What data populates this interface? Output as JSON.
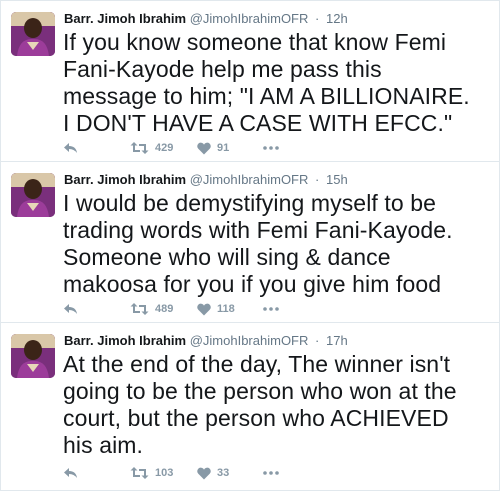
{
  "tweets": [
    {
      "author_name": "Barr. Jimoh Ibrahim",
      "handle": "@JimohIbrahimOFR",
      "separator": "·",
      "time": "12h",
      "text": "If you know someone that know Femi Fani-Kayode help me pass this message to him; \"I AM A BILLIONAIRE. I DON'T HAVE A CASE WITH EFCC.\"",
      "retweets": "429",
      "likes": "91",
      "icons": {
        "reply": "reply-icon",
        "retweet": "retweet-icon",
        "like": "heart-icon",
        "more": "more-dots-icon"
      }
    },
    {
      "author_name": "Barr. Jimoh Ibrahim",
      "handle": "@JimohIbrahimOFR",
      "separator": "·",
      "time": "15h",
      "text": "I would be demystifying myself to be trading words with Femi Fani-Kayode. Someone who will sing & dance makoosa for you if you give him food",
      "retweets": "489",
      "likes": "118",
      "icons": {
        "reply": "reply-icon",
        "retweet": "retweet-icon",
        "like": "heart-icon",
        "more": "more-dots-icon"
      }
    },
    {
      "author_name": "Barr. Jimoh Ibrahim",
      "handle": "@JimohIbrahimOFR",
      "separator": "·",
      "time": "17h",
      "text": "At the end of the day, The winner isn't going to be the person who won at the court, but the person who ACHIEVED his aim.",
      "retweets": "103",
      "likes": "33",
      "icons": {
        "reply": "reply-icon",
        "retweet": "retweet-icon",
        "like": "heart-icon",
        "more": "more-dots-icon"
      }
    }
  ],
  "colors": {
    "text": "#14171a",
    "meta": "#657786",
    "action": "#8899a6",
    "divider": "#e1e8ed",
    "avatar_bg": "#6a2a6e"
  }
}
